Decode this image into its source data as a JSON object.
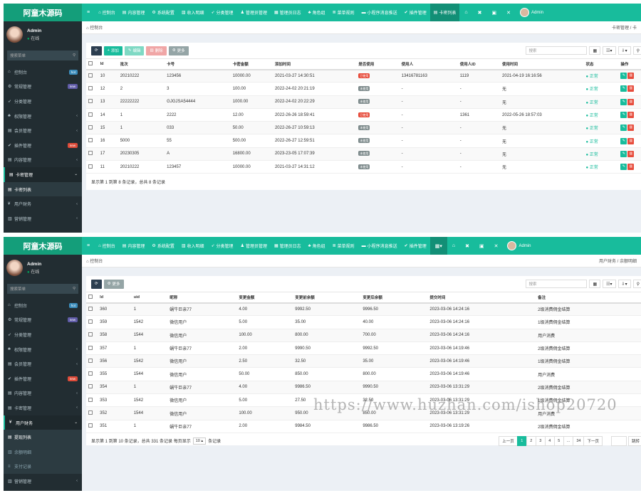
{
  "top": {
    "logo": "阿童木源码",
    "menu_icon": "≡",
    "nav": [
      {
        "icon": "⌂",
        "label": "控制台"
      },
      {
        "icon": "▤",
        "label": "内容管理"
      },
      {
        "icon": "⚙",
        "label": "系统配置"
      },
      {
        "icon": "▥",
        "label": "收入明细"
      },
      {
        "icon": "➶",
        "label": "分类管理"
      },
      {
        "icon": "♟",
        "label": "管理员管理"
      },
      {
        "icon": "▦",
        "label": "管理员日志"
      },
      {
        "icon": "♣",
        "label": "角色组"
      },
      {
        "icon": "≣",
        "label": "菜单规则"
      },
      {
        "icon": "▬",
        "label": "小程序消息推送"
      },
      {
        "icon": "✔",
        "label": "插件管理"
      },
      {
        "icon": "▤",
        "label": "卡密列表"
      }
    ],
    "nav2": [
      {
        "icon": "⌂",
        "label": "控制台"
      },
      {
        "icon": "▤",
        "label": "内容管理"
      },
      {
        "icon": "⚙",
        "label": "系统配置"
      },
      {
        "icon": "▥",
        "label": "收入明细"
      },
      {
        "icon": "➶",
        "label": "分类管理"
      },
      {
        "icon": "♟",
        "label": "管理员管理"
      },
      {
        "icon": "▦",
        "label": "管理员日志"
      },
      {
        "icon": "♣",
        "label": "角色组"
      },
      {
        "icon": "≣",
        "label": "菜单规则"
      },
      {
        "icon": "▬",
        "label": "小程序消息推送"
      },
      {
        "icon": "✔",
        "label": "插件管理"
      }
    ],
    "icons": [
      "⌂",
      "✖",
      "▣",
      "✕"
    ],
    "user": "Admin"
  },
  "sidebar": {
    "name": "Admin",
    "status": "在线",
    "search_placeholder": "搜索菜单",
    "items": [
      {
        "icon": "⌂",
        "label": "控制台",
        "badge": "hot",
        "badge_type": "hot"
      },
      {
        "icon": "⚙",
        "label": "常规管理",
        "badge": "new",
        "badge_type": "new"
      },
      {
        "icon": "➶",
        "label": "分类管理",
        "badge": "",
        "badge_type": ""
      },
      {
        "icon": "♣",
        "label": "权限管理",
        "badge": "‹",
        "badge_type": "arrow"
      },
      {
        "icon": "▤",
        "label": "会员管理",
        "badge": "‹",
        "badge_type": "arrow"
      },
      {
        "icon": "✔",
        "label": "插件管理",
        "badge": "new",
        "badge_type": "red"
      },
      {
        "icon": "▤",
        "label": "内容管理",
        "badge": "‹",
        "badge_type": "arrow"
      }
    ],
    "p1_open": {
      "icon": "▤",
      "label": "卡密管理",
      "arrow": "⌄"
    },
    "p1_sub": [
      {
        "icon": "▤",
        "label": "卡密列表"
      }
    ],
    "p1_after": [
      {
        "icon": "¥",
        "label": "用户财务",
        "badge": "‹"
      },
      {
        "icon": "▥",
        "label": "营销管理",
        "badge": "‹"
      }
    ],
    "p2_before_open": [
      {
        "icon": "▤",
        "label": "卡密管理",
        "badge": "‹"
      }
    ],
    "p2_open": {
      "icon": "¥",
      "label": "用户财务",
      "arrow": "⌄"
    },
    "p2_sub": [
      {
        "icon": "▤",
        "label": "提现列表"
      },
      {
        "icon": "▥",
        "label": "余额明细"
      },
      {
        "icon": "≡",
        "label": "支付记录"
      }
    ],
    "p2_after": [
      {
        "icon": "▥",
        "label": "营销管理",
        "badge": "‹"
      }
    ]
  },
  "panel1": {
    "breadcrumb_left": "控制台",
    "breadcrumb_right": "卡密管理 / 卡",
    "buttons": {
      "refresh": "⟳",
      "add": "添加",
      "edit": "编辑",
      "del": "删除",
      "more": "更多"
    },
    "search_placeholder": "搜索",
    "columns": [
      "Id",
      "批次",
      "卡号",
      "卡密金额",
      "添加时间",
      "是否使用",
      "使用人",
      "使用人ID",
      "使用时间",
      "状态",
      "操作"
    ],
    "rows": [
      {
        "id": "10",
        "batch": "20210222",
        "card": "123456",
        "amount": "10000.00",
        "added": "2021-03-27 14:30:51",
        "used": "已使用",
        "user": "13416781163",
        "uid": "1119",
        "usetime": "2021-04-19 16:16:56",
        "status": "正常"
      },
      {
        "id": "12",
        "batch": "2",
        "card": "3",
        "amount": "100.00",
        "added": "2022-24-02 20:21:19",
        "used": "未使用",
        "user": "-",
        "uid": "-",
        "usetime": "无",
        "status": "正常"
      },
      {
        "id": "13",
        "batch": "22222222",
        "card": "GJGJSA54444",
        "amount": "1000.00",
        "added": "2022-24-02 20:22:29",
        "used": "未使用",
        "user": "-",
        "uid": "-",
        "usetime": "无",
        "status": "正常"
      },
      {
        "id": "14",
        "batch": "1",
        "card": "2222",
        "amount": "12.00",
        "added": "2022-26-26 18:59:41",
        "used": "已使用",
        "user": "-",
        "uid": "1361",
        "usetime": "2022-05-26 18:57:03",
        "status": "正常"
      },
      {
        "id": "15",
        "batch": "1",
        "card": "033",
        "amount": "50.00",
        "added": "2022-26-27 10:59:13",
        "used": "未使用",
        "user": "-",
        "uid": "-",
        "usetime": "无",
        "status": "正常"
      },
      {
        "id": "16",
        "batch": "5000",
        "card": "55",
        "amount": "500.00",
        "added": "2022-26-27 12:59:51",
        "used": "未使用",
        "user": "-",
        "uid": "-",
        "usetime": "无",
        "status": "正常"
      },
      {
        "id": "17",
        "batch": "20230305",
        "card": "A",
        "amount": "16800.00",
        "added": "2023-23-05 17:07:39",
        "used": "未使用",
        "user": "-",
        "uid": "-",
        "usetime": "无",
        "status": "正常"
      },
      {
        "id": "11",
        "batch": "20210222",
        "card": "123457",
        "amount": "10000.00",
        "added": "2021-03-27 14:31:12",
        "used": "未使用",
        "user": "-",
        "uid": "-",
        "usetime": "无",
        "status": "正常"
      }
    ],
    "footer": "显示第 1 到第 8 条记录，总共 8 条记录"
  },
  "panel2": {
    "breadcrumb_left": "控制台",
    "breadcrumb_right": "用户财务 / 余额明细",
    "buttons": {
      "refresh": "⟳",
      "more": "更多"
    },
    "search_placeholder": "搜索",
    "columns": [
      "Id",
      "uid",
      "昵称",
      "变更金额",
      "变更前余额",
      "变更后余额",
      "提交时间",
      "备注"
    ],
    "rows": [
      {
        "id": "360",
        "uid": "1",
        "nick": "蜗牛巨亲77",
        "amt": "4.00",
        "before": "9992.50",
        "after": "9996.50",
        "time": "2023-03-06 14:24:16",
        "note": "2级消费佣金结算"
      },
      {
        "id": "359",
        "uid": "1542",
        "nick": "微信用户",
        "amt": "5.00",
        "before": "35.00",
        "after": "40.00",
        "time": "2023-03-06 14:24:16",
        "note": "1级消费佣金结算"
      },
      {
        "id": "358",
        "uid": "1544",
        "nick": "微信用户",
        "amt": "100.00",
        "before": "800.00",
        "after": "700.00",
        "time": "2023-03-06 14:24:16",
        "note": "用户消费"
      },
      {
        "id": "357",
        "uid": "1",
        "nick": "蜗牛巨亲77",
        "amt": "2.00",
        "before": "9990.50",
        "after": "9992.50",
        "time": "2023-03-06 14:19:46",
        "note": "2级消费佣金结算"
      },
      {
        "id": "356",
        "uid": "1542",
        "nick": "微信用户",
        "amt": "2.50",
        "before": "32.50",
        "after": "35.00",
        "time": "2023-03-06 14:19:46",
        "note": "1级消费佣金结算"
      },
      {
        "id": "355",
        "uid": "1544",
        "nick": "微信用户",
        "amt": "50.00",
        "before": "850.00",
        "after": "800.00",
        "time": "2023-03-06 14:19:46",
        "note": "用户消费"
      },
      {
        "id": "354",
        "uid": "1",
        "nick": "蜗牛巨亲77",
        "amt": "4.00",
        "before": "9986.50",
        "after": "9990.50",
        "time": "2023-03-06 13:31:29",
        "note": "2级消费佣金结算"
      },
      {
        "id": "353",
        "uid": "1542",
        "nick": "微信用户",
        "amt": "5.00",
        "before": "27.50",
        "after": "32.50",
        "time": "2023-03-06 13:31:29",
        "note": "1级消费佣金结算"
      },
      {
        "id": "352",
        "uid": "1544",
        "nick": "微信用户",
        "amt": "100.00",
        "before": "950.00",
        "after": "850.00",
        "time": "2023-03-06 13:31:29",
        "note": "用户消费"
      },
      {
        "id": "351",
        "uid": "1",
        "nick": "蜗牛巨亲77",
        "amt": "2.00",
        "before": "9984.50",
        "after": "9986.50",
        "time": "2023-03-06 13:19:26",
        "note": "2级消费佣金结算"
      }
    ],
    "footer_text": "显示第 1 到第 10 条记录，总共 331 条记录 每页显示",
    "page_size": "10 ▴",
    "footer_suffix": "条记录",
    "pager": [
      "上一页",
      "1",
      "2",
      "3",
      "4",
      "5",
      "...",
      "34",
      "下一页"
    ],
    "jump_label": "跳转"
  },
  "watermark": "https://www.huzhan.com/ishop20720"
}
